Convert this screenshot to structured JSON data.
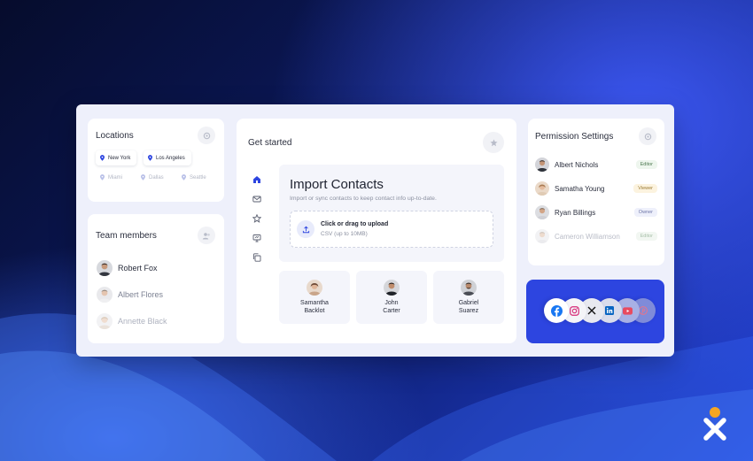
{
  "locations": {
    "title": "Locations",
    "items": [
      {
        "label": "New York",
        "state": "active"
      },
      {
        "label": "Los Angeles",
        "state": "active"
      },
      {
        "label": "Miami",
        "state": "faded"
      },
      {
        "label": "Dallas",
        "state": "faded"
      },
      {
        "label": "Seattle",
        "state": "faded"
      }
    ]
  },
  "team": {
    "title": "Team members",
    "members": [
      {
        "name": "Robert Fox"
      },
      {
        "name": "Albert Flores"
      },
      {
        "name": "Annette Black"
      }
    ]
  },
  "get_started": {
    "title": "Get started",
    "import": {
      "heading": "Import Contacts",
      "subtitle": "Import or sync contacts to keep contact info up-to-date.",
      "upload_title": "Click or drag to upload",
      "upload_hint": "CSV (up to 10MB)"
    },
    "contacts": [
      {
        "first": "Samantha",
        "last": "Backlot"
      },
      {
        "first": "John",
        "last": "Carter"
      },
      {
        "first": "Gabriel",
        "last": "Suarez"
      }
    ]
  },
  "permissions": {
    "title": "Permission Settings",
    "rows": [
      {
        "name": "Albert Nichols",
        "role": "Editor"
      },
      {
        "name": "Samatha Young",
        "role": "Viewer"
      },
      {
        "name": "Ryan Billings",
        "role": "Owner"
      },
      {
        "name": "Cameron Williamson",
        "role": "Editor"
      }
    ]
  },
  "social": {
    "icons": [
      "facebook-icon",
      "instagram-icon",
      "x-icon",
      "linkedin-icon",
      "youtube-icon",
      "pinterest-icon"
    ]
  },
  "colors": {
    "accent": "#2d45e0",
    "brand_orange": "#f5a623"
  }
}
